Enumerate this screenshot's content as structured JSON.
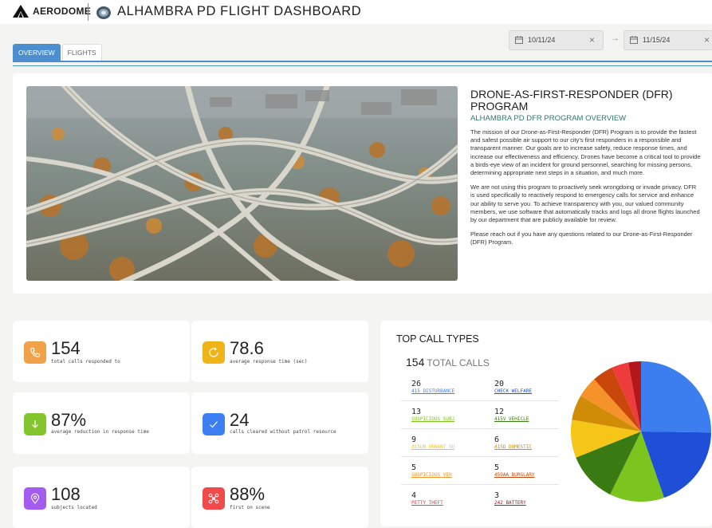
{
  "header": {
    "brand": "AERODOME",
    "title": "ALHAMBRA PD FLIGHT DASHBOARD"
  },
  "tabs": [
    {
      "label": "OVERVIEW",
      "active": true
    },
    {
      "label": "FLIGHTS",
      "active": false
    }
  ],
  "date_range": {
    "start": "10/11/24",
    "end": "11/15/24",
    "separator": "→",
    "clear_icon": "×"
  },
  "program": {
    "title": "DRONE-AS-FIRST-RESPONDER (DFR) PROGRAM",
    "subtitle": "ALHAMBRA PD DFR PROGRAM OVERVIEW",
    "paragraphs": [
      "The mission of our Drone-as-First-Responder (DFR) Program is to provide the fastest and safest possible air support to our city’s first responders in a responsible and transparent manner. Our goals are to increase safety, reduce response times, and increase our effectiveness and efficiency. Drones have become a critical tool to provide a birds-eye view of an incident for ground personnel, searching for missing persons, determining appropriate next steps in a situation, and much more.",
      "We are not using this program to proactively seek wrongdoing or invade privacy. DFR is used specifically to reactively respond to emergency calls for service and enhance our ability to serve you. To achieve transparency with you, our valued community members, we use software that automatically tracks and logs all drone flights launched by our department that are publicly available for review.",
      "Please reach out if you have any questions related to our Drone-as-First-Responder (DFR) Program."
    ]
  },
  "stats": [
    {
      "value": "154",
      "label": "total calls responded to",
      "color": "#f0a14a",
      "icon": "phone-icon"
    },
    {
      "value": "78.6",
      "label": "average response time (sec)",
      "color": "#f0b418",
      "icon": "clock-icon"
    },
    {
      "value": "87%",
      "label": "average reduction in response time",
      "color": "#84c52f",
      "icon": "arrow-down-icon"
    },
    {
      "value": "24",
      "label": "calls cleared without patrol resource",
      "color": "#3d7ff0",
      "icon": "check-icon"
    },
    {
      "value": "108",
      "label": "subjects located",
      "color": "#a35bf0",
      "icon": "location-pin-icon"
    },
    {
      "value": "88%",
      "label": "first on scene",
      "color": "#f04a4a",
      "icon": "drone-icon"
    }
  ],
  "top_calls": {
    "title": "TOP CALL TYPES",
    "total_value": "154",
    "total_label": "TOTAL CALLS",
    "items": [
      {
        "count": "26",
        "label": "415 DISTURBANCE",
        "color": "#3c7df0"
      },
      {
        "count": "20",
        "label": "CHECK WELFARE",
        "color": "#1e4fd6"
      },
      {
        "count": "13",
        "label": "SUSPICIOUS SUBJ",
        "color": "#7cc51f"
      },
      {
        "count": "12",
        "label": "415V VEHICLE",
        "color": "#3a7a12"
      },
      {
        "count": "9",
        "label": "415UN UNWANT SU",
        "color": "#f5c518"
      },
      {
        "count": "6",
        "label": "415D DOMESTIC",
        "color": "#d08c06"
      },
      {
        "count": "5",
        "label": "SUSPICIOUS VEH",
        "color": "#f5922a"
      },
      {
        "count": "5",
        "label": "459AA BURGLARY",
        "color": "#c9470b"
      },
      {
        "count": "4",
        "label": "PETTY THEFT",
        "color": "#ee3b3b"
      },
      {
        "count": "3",
        "label": "242 BATTERY",
        "color": "#b3171a"
      }
    ]
  },
  "chart_data": {
    "type": "pie",
    "categories": [
      "415 DISTURBANCE",
      "CHECK WELFARE",
      "SUSPICIOUS SUBJ",
      "415V VEHICLE",
      "415UN UNWANT SU",
      "415D DOMESTIC",
      "SUSPICIOUS VEH",
      "459AA BURGLARY",
      "PETTY THEFT",
      "242 BATTERY"
    ],
    "values": [
      26,
      20,
      13,
      12,
      9,
      6,
      5,
      5,
      4,
      3
    ],
    "colors": [
      "#3c7df0",
      "#1e4fd6",
      "#7cc51f",
      "#3a7a12",
      "#f5c518",
      "#d08c06",
      "#f5922a",
      "#c9470b",
      "#ee3b3b",
      "#b3171a"
    ]
  }
}
